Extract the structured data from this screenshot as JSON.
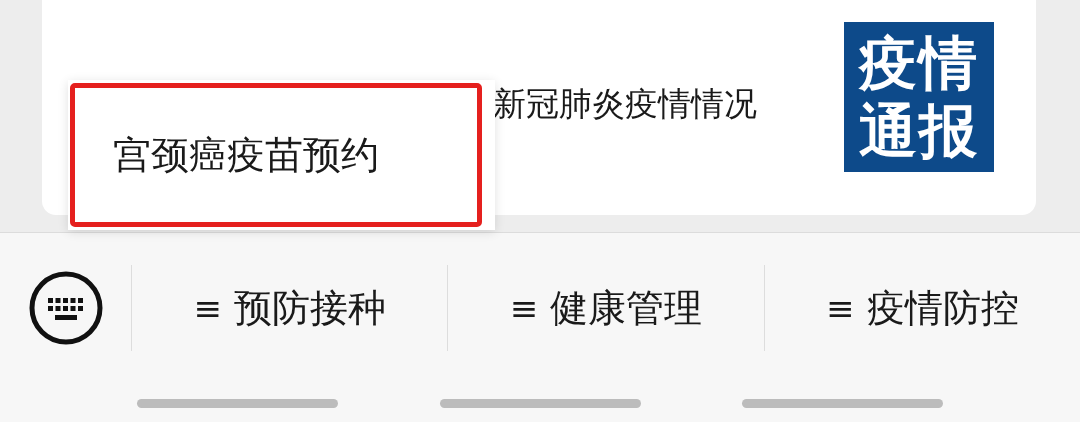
{
  "article": {
    "title": "新冠肺炎疫情情况",
    "thumbnail": {
      "lines": [
        "疫情",
        "通报"
      ]
    }
  },
  "popup_menu": {
    "items": [
      {
        "label": "宫颈癌疫苗预约",
        "highlighted": true
      }
    ]
  },
  "menu_bar": {
    "items": [
      {
        "marker": "≡",
        "label": "预防接种"
      },
      {
        "marker": "≡",
        "label": "健康管理"
      },
      {
        "marker": "≡",
        "label": "疫情防控"
      }
    ]
  }
}
